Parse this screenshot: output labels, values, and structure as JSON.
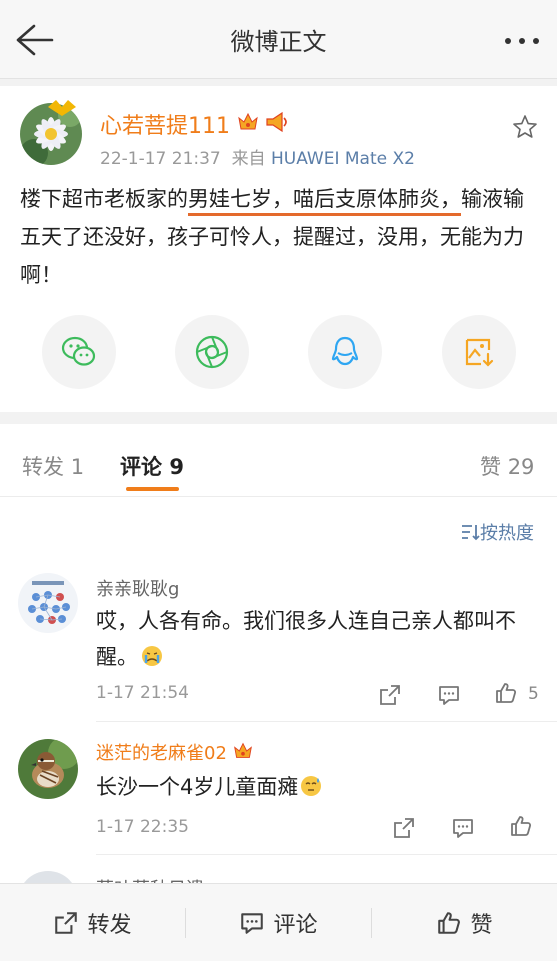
{
  "nav": {
    "title": "微博正文"
  },
  "post": {
    "username": "心若菩提111",
    "time": "22-1-17 21:37",
    "source_prefix": "来自",
    "device": "HUAWEI Mate X2",
    "text_part1": "楼下超市老板家的",
    "text_underlined": "男娃七岁，喵后支原体肺炎，",
    "text_part2": "输液输五天了还没好，孩子可怜人，提醒过，没用，无能为力啊！"
  },
  "share_icons": [
    "wechat-icon",
    "moments-icon",
    "qq-icon",
    "save-image-icon"
  ],
  "tabs": {
    "repost_label": "转发",
    "repost_count": "1",
    "comment_label": "评论",
    "comment_count": "9",
    "like_label": "赞",
    "like_count": "29"
  },
  "sort": {
    "label": "按热度"
  },
  "comments": [
    {
      "name": "亲亲耿耿g",
      "text": "哎，人各有命。我们很多人连自己亲人都叫不醒。",
      "time": "1-17 21:54",
      "likes": "5"
    },
    {
      "name": "迷茫的老麻雀02",
      "text": "长沙一个4岁儿童面瘫",
      "time": "1-17 22:35",
      "likes": ""
    },
    {
      "name": "草叶草秋日遗"
    }
  ],
  "bottom_bar": {
    "repost": "转发",
    "comment": "评论",
    "like": "赞"
  },
  "colors": {
    "accent": "#f07d1a",
    "link": "#5b7ea8",
    "underline": "#e46a2c"
  }
}
